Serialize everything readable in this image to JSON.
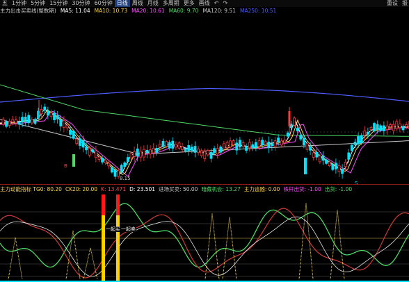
{
  "toolbar": {
    "items": [
      "五",
      "1分钟",
      "5分钟",
      "15分钟",
      "30分钟",
      "60分钟",
      "日线",
      "周线",
      "月线",
      "多周期",
      "更多",
      "画线",
      "↶",
      "↷"
    ],
    "right": [
      "重设",
      "报"
    ]
  },
  "legend": {
    "name": "主力出击买卖线(整数期)",
    "items": [
      {
        "text": "MA5: 11.04",
        "color": "#ffffff"
      },
      {
        "text": "MA10: 10.73",
        "color": "#ffd54a"
      },
      {
        "text": "MA20: 10.61",
        "color": "#ff4dff"
      },
      {
        "text": "MA60: 9.70",
        "color": "#4cd964"
      },
      {
        "text": "MA120: 9.51",
        "color": "#c8c8c8"
      },
      {
        "text": "MA250: 10.51",
        "color": "#4d5dff"
      }
    ]
  },
  "price_labels": {
    "low": "8.15",
    "high": "15.59"
  },
  "markers": {
    "left": "B",
    "right": "S"
  },
  "indicator_legend": {
    "items": [
      {
        "text": "主力动能指标 TG0: 80.20",
        "color": "#ffd54a"
      },
      {
        "text": "CK20: 20.00",
        "color": "#ffd54a"
      },
      {
        "text": "K: 13.471",
        "color": "#ff4d4d"
      },
      {
        "text": "D: 23.501",
        "color": "#ffffff"
      },
      {
        "text": "进场买卖: 50.00",
        "color": "#c8c8c8"
      },
      {
        "text": "暗藏机会: 13.27",
        "color": "#4cd964"
      },
      {
        "text": "主力追随: 0.00",
        "color": "#ffd54a"
      },
      {
        "text": "铁杆出货: -1.00",
        "color": "#ff4dff"
      },
      {
        "text": "出货: -1.00",
        "color": "#4cd964"
      }
    ]
  },
  "sub_annotations": {
    "left": "一起买",
    "right": "一起卖"
  },
  "colors": {
    "up": "#ff3b3b",
    "down": "#00e5ff",
    "ma5": "#ffffff",
    "ma10": "#ffd54a",
    "ma20": "#ff4dff",
    "ma60": "#4cd964",
    "ma120": "#c8c8c8",
    "ma250": "#4d5dff",
    "signal": "#ff1a1a",
    "signal2": "#ffd000"
  }
}
